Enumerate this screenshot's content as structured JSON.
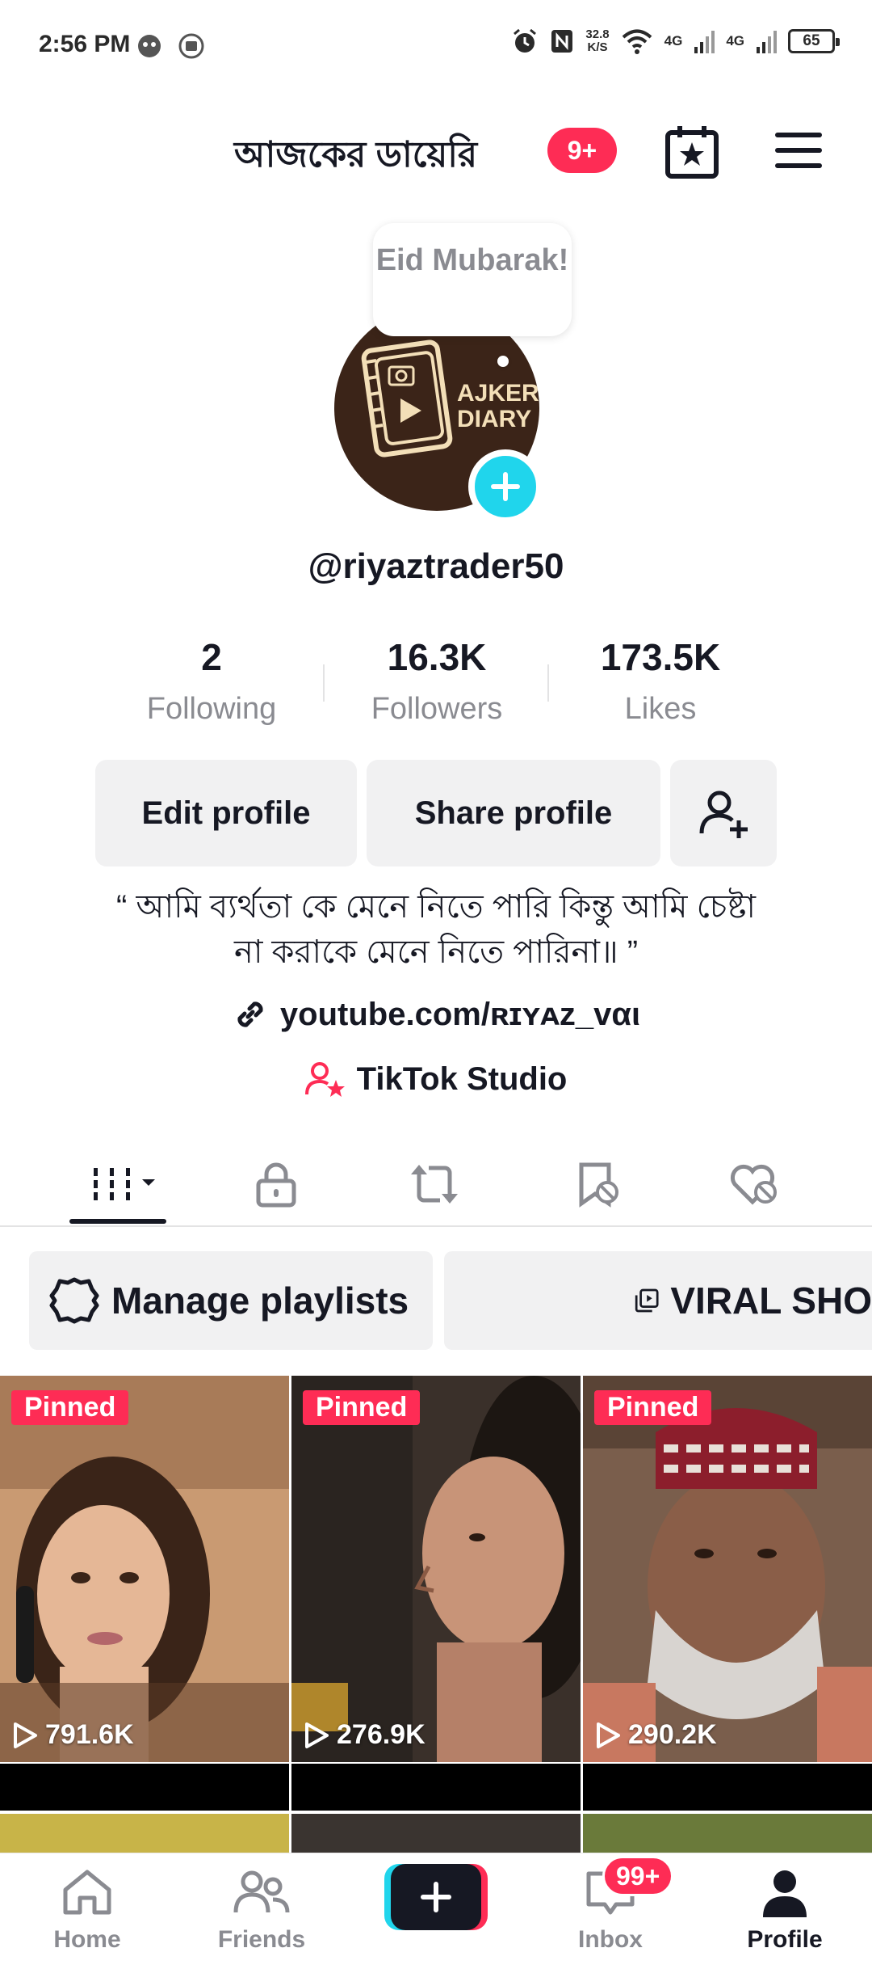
{
  "status_bar": {
    "time": "2:56 PM",
    "speed_value": "32.8",
    "speed_unit": "K/S",
    "net1": "4G",
    "net2": "4G",
    "battery": "65"
  },
  "header": {
    "title": "আজকের ডায়েরি",
    "badge": "9+"
  },
  "profile": {
    "speech_bubble": "Eid Mubarak!",
    "avatar_text_1": "AJKER",
    "avatar_text_2": "DIARY",
    "username": "@riyaztrader50",
    "stats": [
      {
        "value": "2",
        "label": "Following"
      },
      {
        "value": "16.3K",
        "label": "Followers"
      },
      {
        "value": "173.5K",
        "label": "Likes"
      }
    ],
    "edit_label": "Edit profile",
    "share_label": "Share profile",
    "bio_line1": "“ আমি ব্যর্থতা কে মেনে নিতে পারি কিন্তু আমি চেষ্টা",
    "bio_line2": "না করাকে মেনে নিতে পারিনা॥ ”",
    "link": "youtube.com/ʀɪʏᴀᴢ_vαι",
    "studio": "TikTok Studio"
  },
  "playlists": {
    "manage_label": "Manage playlists",
    "playlist_label": "VIRAL SHO"
  },
  "videos": [
    {
      "pinned": "Pinned",
      "views": "791.6K"
    },
    {
      "pinned": "Pinned",
      "views": "276.9K"
    },
    {
      "pinned": "Pinned",
      "views": "290.2K"
    }
  ],
  "bottom_nav": {
    "home": "Home",
    "friends": "Friends",
    "inbox": "Inbox",
    "inbox_badge": "99+",
    "profile": "Profile"
  },
  "colors": {
    "accent_red": "#fe2c55",
    "accent_cyan": "#20d5ec",
    "text_primary": "#161823",
    "text_secondary": "#8a8b91"
  }
}
